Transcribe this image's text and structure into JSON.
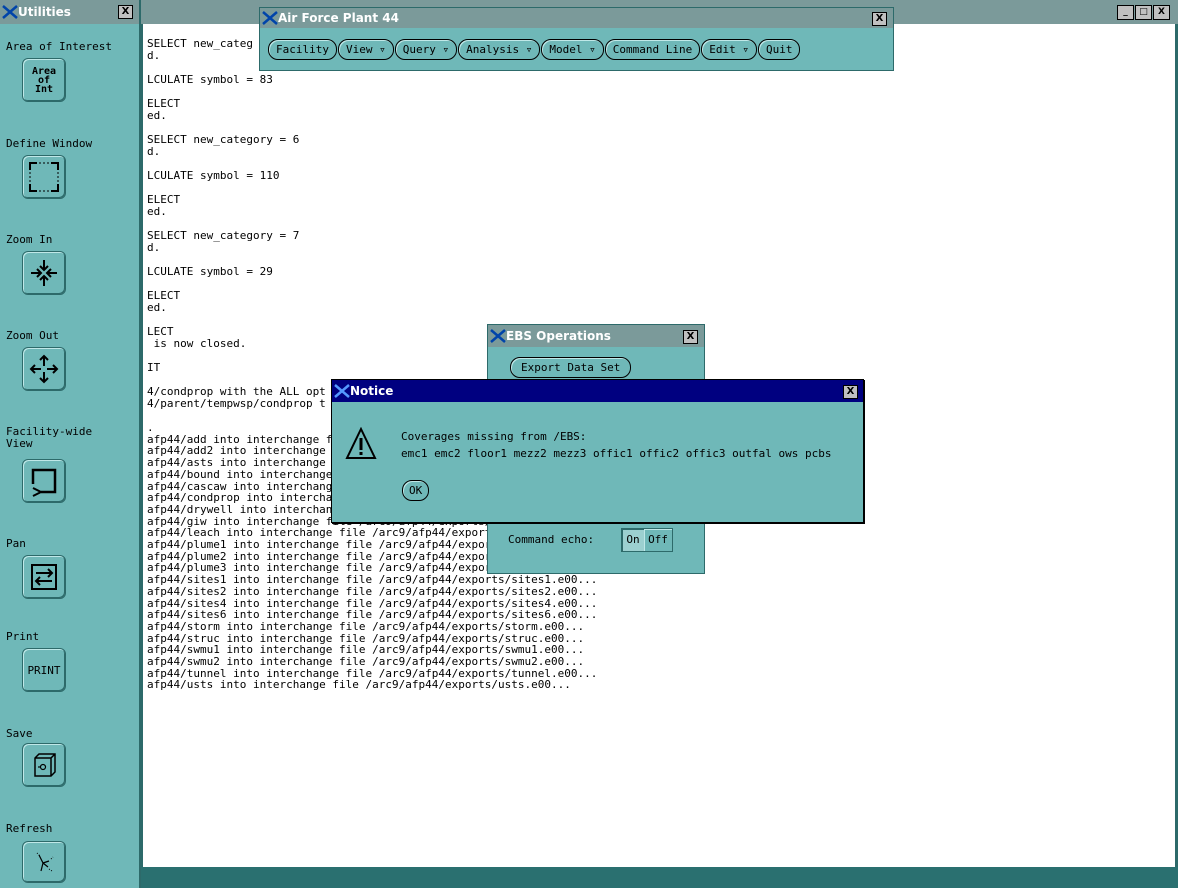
{
  "utilities": {
    "title": "Utilities",
    "close_label": "X",
    "items": [
      {
        "label": "Area of Interest",
        "button_text": "Area\nof\nInt"
      },
      {
        "label": "Define Window"
      },
      {
        "label": "Zoom In"
      },
      {
        "label": "Zoom Out"
      },
      {
        "label": "Facility-wide\nView"
      },
      {
        "label": "Pan"
      },
      {
        "label": "Print",
        "button_text": "PRINT"
      },
      {
        "label": "Save"
      },
      {
        "label": "Refresh"
      }
    ]
  },
  "main_window": {
    "controls": [
      "_",
      "□",
      "X"
    ],
    "lines": [
      "SELECT new_categ",
      "d.",
      "",
      "LCULATE symbol = 83",
      "",
      "ELECT",
      "ed.",
      "",
      "SELECT new_category = 6",
      "d.",
      "",
      "LCULATE symbol = 110",
      "",
      "ELECT",
      "ed.",
      "",
      "SELECT new_category = 7",
      "d.",
      "",
      "LCULATE symbol = 29",
      "",
      "ELECT",
      "ed.",
      "",
      "LECT",
      " is now closed.",
      "",
      "IT",
      "",
      "4/condprop with the ALL opt",
      "4/parent/tempwsp/condprop t",
      "",
      ".",
      "afp44/add into interchange file /arc9/afp44/expor",
      "afp44/add2 into interchange file /arc9/afp44/expor",
      "afp44/asts into interchange file /arc9/afp44/expor",
      "afp44/bound into interchange file /arc9/afp44/exp",
      "afp44/cascaw into interchange file /arc9/afp44/exports/cascaw.e00...",
      "afp44/condprop into interchange file /arc9/afp44/exports/condprop.e00...",
      "afp44/drywell into interchange file /arc9/afp44/exports/drywell.e00...",
      "afp44/giw into interchange file /arc9/afp44/exports/giw.e00...",
      "afp44/leach into interchange file /arc9/afp44/exports/leach.e00...",
      "afp44/plume1 into interchange file /arc9/afp44/exports/plume1.e00...",
      "afp44/plume2 into interchange file /arc9/afp44/exports/plume2.e00...",
      "afp44/plume3 into interchange file /arc9/afp44/exports/plume3.e00...",
      "afp44/sites1 into interchange file /arc9/afp44/exports/sites1.e00...",
      "afp44/sites2 into interchange file /arc9/afp44/exports/sites2.e00...",
      "afp44/sites4 into interchange file /arc9/afp44/exports/sites4.e00...",
      "afp44/sites6 into interchange file /arc9/afp44/exports/sites6.e00...",
      "afp44/storm into interchange file /arc9/afp44/exports/storm.e00...",
      "afp44/struc into interchange file /arc9/afp44/exports/struc.e00...",
      "afp44/swmu1 into interchange file /arc9/afp44/exports/swmu1.e00...",
      "afp44/swmu2 into interchange file /arc9/afp44/exports/swmu2.e00...",
      "afp44/tunnel into interchange file /arc9/afp44/exports/tunnel.e00...",
      "afp44/usts into interchange file /arc9/afp44/exports/usts.e00..."
    ]
  },
  "afp_window": {
    "title": "Air Force Plant 44",
    "close_label": "X",
    "menu": [
      {
        "label": "Facility"
      },
      {
        "label": "View",
        "dropdown": true
      },
      {
        "label": "Query",
        "dropdown": true
      },
      {
        "label": "Analysis",
        "dropdown": true
      },
      {
        "label": "Model",
        "dropdown": true
      },
      {
        "label": "Command Line"
      },
      {
        "label": "Edit",
        "dropdown": true
      },
      {
        "label": "Quit"
      }
    ]
  },
  "ebs_window": {
    "title": "EBS Operations",
    "close_label": "X",
    "export_button": "Export Data Set",
    "command_echo_label": "Command echo:",
    "on_label": "On",
    "off_label": "Off"
  },
  "notice": {
    "title": "Notice",
    "close_label": "X",
    "message_line1": "Coverages missing from /EBS:",
    "message_line2": "emc1 emc2 floor1 mezz2 mezz3 offic1 offic2 offic3 outfal ows pcbs",
    "ok_label": "OK"
  },
  "colors": {
    "panel_bg": "#6fb8b8",
    "titlebar_inactive": "#7b9a9a",
    "titlebar_active": "#000080",
    "statusbar": "#2a7070"
  }
}
